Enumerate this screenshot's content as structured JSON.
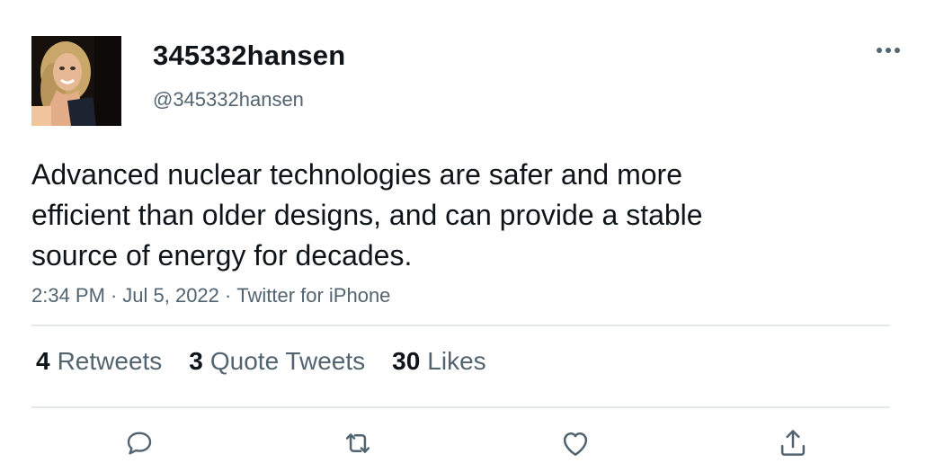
{
  "user": {
    "display_name": "345332hansen",
    "handle": "@345332hansen"
  },
  "tweet": {
    "text": "Advanced nuclear technologies are safer and more\nefficient than older designs, and can provide a stable\nsource of energy for decades.",
    "time": "2:34 PM",
    "date": "Jul 5, 2022",
    "source": "Twitter for iPhone"
  },
  "stats": [
    {
      "count": "4",
      "label": "Retweets"
    },
    {
      "count": "3",
      "label": "Quote Tweets"
    },
    {
      "count": "30",
      "label": "Likes"
    }
  ],
  "actions": [
    {
      "icon": "reply-icon"
    },
    {
      "icon": "retweet-icon"
    },
    {
      "icon": "like-icon"
    },
    {
      "icon": "share-icon"
    }
  ],
  "colors": {
    "text": "#0f1419",
    "secondary": "#536471",
    "divider": "#e4e7ea"
  }
}
